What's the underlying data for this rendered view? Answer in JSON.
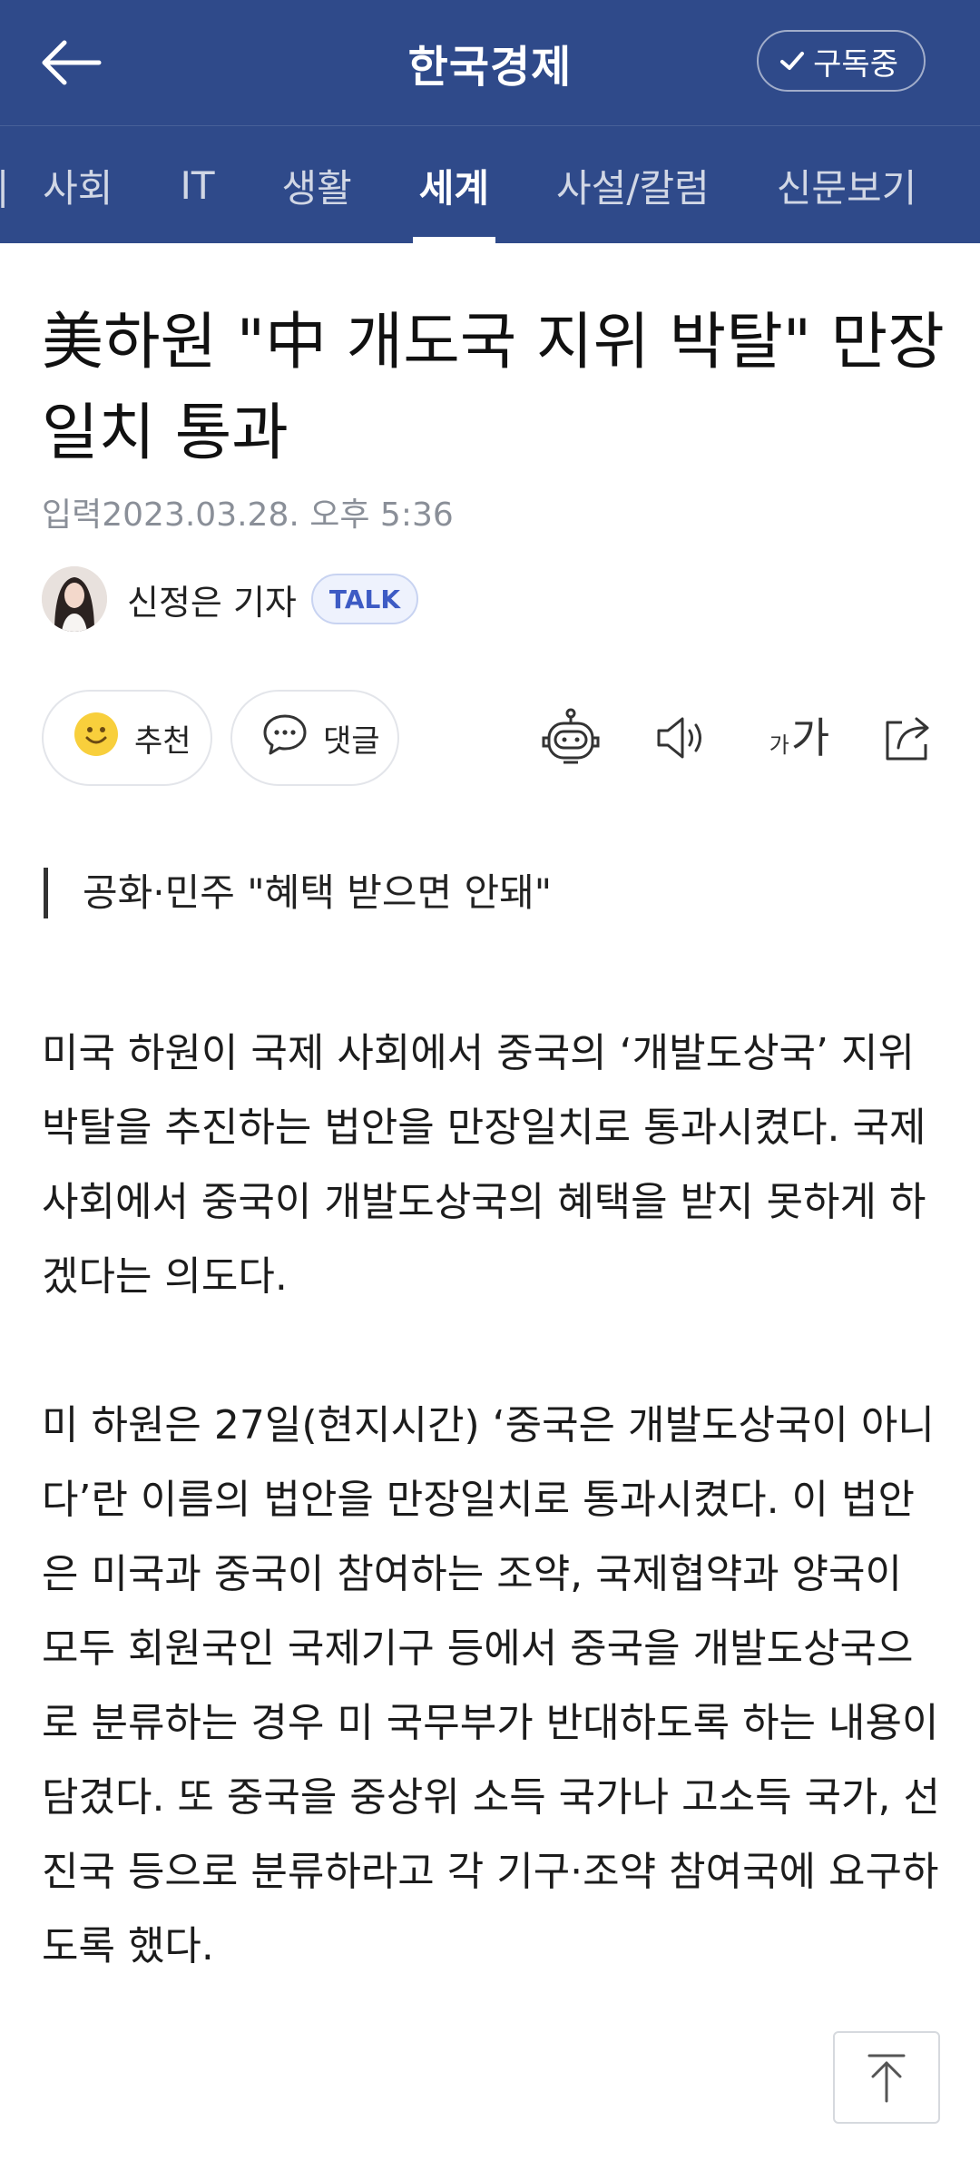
{
  "header": {
    "brand": "한국경제",
    "subscribe_label": "구독중",
    "icons": {
      "back": "arrow-left-icon",
      "subscribe": "check-icon"
    },
    "colors": {
      "bar": "#2f4a8a",
      "text": "#ffffff"
    }
  },
  "tabs": {
    "items": [
      {
        "label": "사회"
      },
      {
        "label": "IT"
      },
      {
        "label": "생활"
      },
      {
        "label": "세계",
        "active": true
      },
      {
        "label": "사설/칼럼"
      },
      {
        "label": "신문보기"
      }
    ]
  },
  "article": {
    "headline": "美하원 \"中 개도국 지위 박탈\" 만장일치 통과",
    "date": "입력2023.03.28. 오후 5:36",
    "author": {
      "name": "신정은 기자",
      "badge": "TALK"
    },
    "actions": {
      "recommend_label": "추천",
      "comment_label": "댓글",
      "font_small": "가",
      "font_big": "가",
      "icons": [
        "smile-icon",
        "comment-bubble-icon",
        "robot-icon",
        "speaker-icon",
        "font-size-icon",
        "share-icon"
      ]
    },
    "subhead": "공화·민주 \"혜택 받으면 안돼\"",
    "paragraphs": [
      "미국 하원이 국제 사회에서 중국의 ‘개발도상국’ 지위 박탈을 추진하는 법안을 만장일치로 통과시켰다. 국제 사회에서 중국이 개발도상국의 혜택을 받지 못하게 하겠다는 의도다.",
      "미 하원은 27일(현지시간) ‘중국은 개발도상국이 아니다’란 이름의 법안을 만장일치로 통과시켰다. 이 법안은 미국과 중국이 참여하는 조약, 국제협약과 양국이 모두 회원국인 국제기구 등에서 중국을 개발도상국으로 분류하는 경우 미 국무부가 반대하도록 하는 내용이 담겼다. 또 중국을 중상위 소득 국가나 고소득 국가, 선진국 등으로 분류하라고 각 기구·조약 참여국에 요구하도록 했다."
    ]
  },
  "scroll_top_icon": "arrow-up-icon"
}
